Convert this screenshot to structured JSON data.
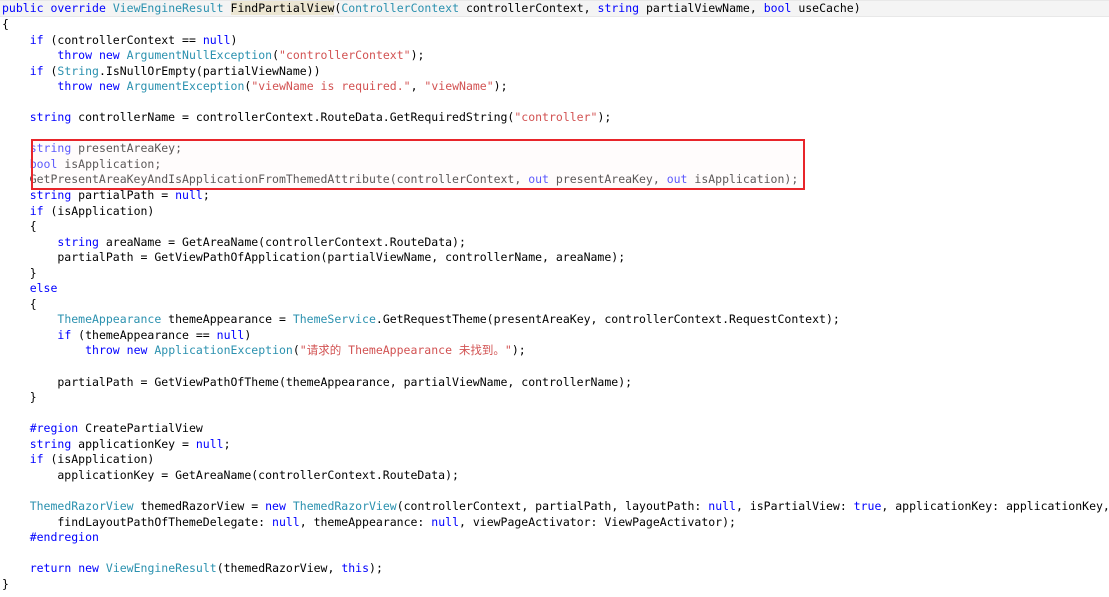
{
  "editor": {
    "language": "csharp",
    "colors": {
      "background": "#ffffff",
      "text": "#000000",
      "keyword": "#0000ff",
      "type": "#2b91af",
      "string": "#d25252",
      "preprocessor": "#0000ff",
      "current_line_background": "#f4f4f4",
      "symbol_highlight": "#ece6d2",
      "annotation_box": "#e8252a"
    },
    "annotation": {
      "name": "red-rectangle-highlight",
      "shape": "rectangle",
      "color": "#e8252a",
      "encloses_lines": [
        10,
        11,
        12
      ]
    },
    "lines": [
      {
        "n": 1,
        "current": true,
        "tokens": [
          {
            "t": "kw",
            "s": "public"
          },
          {
            "t": "plain",
            "s": " "
          },
          {
            "t": "kw",
            "s": "override"
          },
          {
            "t": "plain",
            "s": " "
          },
          {
            "t": "type",
            "s": "ViewEngineResult"
          },
          {
            "t": "plain",
            "s": " "
          },
          {
            "t": "hl",
            "s": "FindPartialView"
          },
          {
            "t": "plain",
            "s": "("
          },
          {
            "t": "type",
            "s": "ControllerContext"
          },
          {
            "t": "plain",
            "s": " controllerContext, "
          },
          {
            "t": "kw",
            "s": "string"
          },
          {
            "t": "plain",
            "s": " partialViewName, "
          },
          {
            "t": "kw",
            "s": "bool"
          },
          {
            "t": "plain",
            "s": " useCache)"
          }
        ]
      },
      {
        "n": 2,
        "tokens": [
          {
            "t": "plain",
            "s": "{"
          }
        ]
      },
      {
        "n": 3,
        "tokens": [
          {
            "t": "plain",
            "s": "    "
          },
          {
            "t": "kw",
            "s": "if"
          },
          {
            "t": "plain",
            "s": " (controllerContext == "
          },
          {
            "t": "kw",
            "s": "null"
          },
          {
            "t": "plain",
            "s": ")"
          }
        ]
      },
      {
        "n": 4,
        "tokens": [
          {
            "t": "plain",
            "s": "        "
          },
          {
            "t": "kw",
            "s": "throw"
          },
          {
            "t": "plain",
            "s": " "
          },
          {
            "t": "kw",
            "s": "new"
          },
          {
            "t": "plain",
            "s": " "
          },
          {
            "t": "type",
            "s": "ArgumentNullException"
          },
          {
            "t": "plain",
            "s": "("
          },
          {
            "t": "str",
            "s": "\"controllerContext\""
          },
          {
            "t": "plain",
            "s": ");"
          }
        ]
      },
      {
        "n": 5,
        "tokens": [
          {
            "t": "plain",
            "s": "    "
          },
          {
            "t": "kw",
            "s": "if"
          },
          {
            "t": "plain",
            "s": " ("
          },
          {
            "t": "type",
            "s": "String"
          },
          {
            "t": "plain",
            "s": ".IsNullOrEmpty(partialViewName))"
          }
        ]
      },
      {
        "n": 6,
        "tokens": [
          {
            "t": "plain",
            "s": "        "
          },
          {
            "t": "kw",
            "s": "throw"
          },
          {
            "t": "plain",
            "s": " "
          },
          {
            "t": "kw",
            "s": "new"
          },
          {
            "t": "plain",
            "s": " "
          },
          {
            "t": "type",
            "s": "ArgumentException"
          },
          {
            "t": "plain",
            "s": "("
          },
          {
            "t": "str",
            "s": "\"viewName is required.\""
          },
          {
            "t": "plain",
            "s": ", "
          },
          {
            "t": "str",
            "s": "\"viewName\""
          },
          {
            "t": "plain",
            "s": ");"
          }
        ]
      },
      {
        "n": 7,
        "tokens": [
          {
            "t": "plain",
            "s": ""
          }
        ]
      },
      {
        "n": 8,
        "tokens": [
          {
            "t": "plain",
            "s": "    "
          },
          {
            "t": "kw",
            "s": "string"
          },
          {
            "t": "plain",
            "s": " controllerName = controllerContext.RouteData.GetRequiredString("
          },
          {
            "t": "str",
            "s": "\"controller\""
          },
          {
            "t": "plain",
            "s": ");"
          }
        ]
      },
      {
        "n": 9,
        "tokens": [
          {
            "t": "plain",
            "s": ""
          }
        ]
      },
      {
        "n": 10,
        "tokens": [
          {
            "t": "plain",
            "s": "    "
          },
          {
            "t": "kw",
            "s": "string"
          },
          {
            "t": "plain",
            "s": " presentAreaKey;"
          }
        ]
      },
      {
        "n": 11,
        "tokens": [
          {
            "t": "plain",
            "s": "    "
          },
          {
            "t": "kw",
            "s": "bool"
          },
          {
            "t": "plain",
            "s": " isApplication;"
          }
        ]
      },
      {
        "n": 12,
        "tokens": [
          {
            "t": "plain",
            "s": "    GetPresentAreaKeyAndIsApplicationFromThemedAttribute(controllerContext, "
          },
          {
            "t": "kw",
            "s": "out"
          },
          {
            "t": "plain",
            "s": " presentAreaKey, "
          },
          {
            "t": "kw",
            "s": "out"
          },
          {
            "t": "plain",
            "s": " isApplication);"
          }
        ]
      },
      {
        "n": 13,
        "tokens": [
          {
            "t": "plain",
            "s": "    "
          },
          {
            "t": "kw",
            "s": "string"
          },
          {
            "t": "plain",
            "s": " partialPath = "
          },
          {
            "t": "kw",
            "s": "null"
          },
          {
            "t": "plain",
            "s": ";"
          }
        ]
      },
      {
        "n": 14,
        "tokens": [
          {
            "t": "plain",
            "s": "    "
          },
          {
            "t": "kw",
            "s": "if"
          },
          {
            "t": "plain",
            "s": " (isApplication)"
          }
        ]
      },
      {
        "n": 15,
        "tokens": [
          {
            "t": "plain",
            "s": "    {"
          }
        ]
      },
      {
        "n": 16,
        "tokens": [
          {
            "t": "plain",
            "s": "        "
          },
          {
            "t": "kw",
            "s": "string"
          },
          {
            "t": "plain",
            "s": " areaName = GetAreaName(controllerContext.RouteData);"
          }
        ]
      },
      {
        "n": 17,
        "tokens": [
          {
            "t": "plain",
            "s": "        partialPath = GetViewPathOfApplication(partialViewName, controllerName, areaName);"
          }
        ]
      },
      {
        "n": 18,
        "tokens": [
          {
            "t": "plain",
            "s": "    }"
          }
        ]
      },
      {
        "n": 19,
        "tokens": [
          {
            "t": "plain",
            "s": "    "
          },
          {
            "t": "kw",
            "s": "else"
          }
        ]
      },
      {
        "n": 20,
        "tokens": [
          {
            "t": "plain",
            "s": "    {"
          }
        ]
      },
      {
        "n": 21,
        "tokens": [
          {
            "t": "plain",
            "s": "        "
          },
          {
            "t": "type",
            "s": "ThemeAppearance"
          },
          {
            "t": "plain",
            "s": " themeAppearance = "
          },
          {
            "t": "type",
            "s": "ThemeService"
          },
          {
            "t": "plain",
            "s": ".GetRequestTheme(presentAreaKey, controllerContext.RequestContext);"
          }
        ]
      },
      {
        "n": 22,
        "tokens": [
          {
            "t": "plain",
            "s": "        "
          },
          {
            "t": "kw",
            "s": "if"
          },
          {
            "t": "plain",
            "s": " (themeAppearance == "
          },
          {
            "t": "kw",
            "s": "null"
          },
          {
            "t": "plain",
            "s": ")"
          }
        ]
      },
      {
        "n": 23,
        "tokens": [
          {
            "t": "plain",
            "s": "            "
          },
          {
            "t": "kw",
            "s": "throw"
          },
          {
            "t": "plain",
            "s": " "
          },
          {
            "t": "kw",
            "s": "new"
          },
          {
            "t": "plain",
            "s": " "
          },
          {
            "t": "type",
            "s": "ApplicationException"
          },
          {
            "t": "plain",
            "s": "("
          },
          {
            "t": "str",
            "s": "\"请求的 ThemeAppearance 未找到。\""
          },
          {
            "t": "plain",
            "s": ");"
          }
        ]
      },
      {
        "n": 24,
        "tokens": [
          {
            "t": "plain",
            "s": ""
          }
        ]
      },
      {
        "n": 25,
        "tokens": [
          {
            "t": "plain",
            "s": "        partialPath = GetViewPathOfTheme(themeAppearance, partialViewName, controllerName);"
          }
        ]
      },
      {
        "n": 26,
        "tokens": [
          {
            "t": "plain",
            "s": "    }"
          }
        ]
      },
      {
        "n": 27,
        "tokens": [
          {
            "t": "plain",
            "s": ""
          }
        ]
      },
      {
        "n": 28,
        "tokens": [
          {
            "t": "plain",
            "s": "    "
          },
          {
            "t": "pp",
            "s": "#region"
          },
          {
            "t": "plain",
            "s": " CreatePartialView"
          }
        ]
      },
      {
        "n": 29,
        "tokens": [
          {
            "t": "plain",
            "s": "    "
          },
          {
            "t": "kw",
            "s": "string"
          },
          {
            "t": "plain",
            "s": " applicationKey = "
          },
          {
            "t": "kw",
            "s": "null"
          },
          {
            "t": "plain",
            "s": ";"
          }
        ]
      },
      {
        "n": 30,
        "tokens": [
          {
            "t": "plain",
            "s": "    "
          },
          {
            "t": "kw",
            "s": "if"
          },
          {
            "t": "plain",
            "s": " (isApplication)"
          }
        ]
      },
      {
        "n": 31,
        "tokens": [
          {
            "t": "plain",
            "s": "        applicationKey = GetAreaName(controllerContext.RouteData);"
          }
        ]
      },
      {
        "n": 32,
        "tokens": [
          {
            "t": "plain",
            "s": ""
          }
        ]
      },
      {
        "n": 33,
        "tokens": [
          {
            "t": "plain",
            "s": "    "
          },
          {
            "t": "type",
            "s": "ThemedRazorView"
          },
          {
            "t": "plain",
            "s": " themedRazorView = "
          },
          {
            "t": "kw",
            "s": "new"
          },
          {
            "t": "plain",
            "s": " "
          },
          {
            "t": "type",
            "s": "ThemedRazorView"
          },
          {
            "t": "plain",
            "s": "(controllerContext, partialPath, layoutPath: "
          },
          {
            "t": "kw",
            "s": "null"
          },
          {
            "t": "plain",
            "s": ", isPartialView: "
          },
          {
            "t": "kw",
            "s": "true"
          },
          {
            "t": "plain",
            "s": ", applicationKey: applicationKey,"
          }
        ]
      },
      {
        "n": 34,
        "tokens": [
          {
            "t": "plain",
            "s": "        findLayoutPathOfThemeDelegate: "
          },
          {
            "t": "kw",
            "s": "null"
          },
          {
            "t": "plain",
            "s": ", themeAppearance: "
          },
          {
            "t": "kw",
            "s": "null"
          },
          {
            "t": "plain",
            "s": ", viewPageActivator: ViewPageActivator);"
          }
        ]
      },
      {
        "n": 35,
        "tokens": [
          {
            "t": "plain",
            "s": "    "
          },
          {
            "t": "pp",
            "s": "#endregion"
          }
        ]
      },
      {
        "n": 36,
        "tokens": [
          {
            "t": "plain",
            "s": ""
          }
        ]
      },
      {
        "n": 37,
        "tokens": [
          {
            "t": "plain",
            "s": "    "
          },
          {
            "t": "kw",
            "s": "return"
          },
          {
            "t": "plain",
            "s": " "
          },
          {
            "t": "kw",
            "s": "new"
          },
          {
            "t": "plain",
            "s": " "
          },
          {
            "t": "type",
            "s": "ViewEngineResult"
          },
          {
            "t": "plain",
            "s": "(themedRazorView, "
          },
          {
            "t": "kw",
            "s": "this"
          },
          {
            "t": "plain",
            "s": ");"
          }
        ]
      },
      {
        "n": 38,
        "tokens": [
          {
            "t": "plain",
            "s": "}"
          }
        ]
      }
    ]
  }
}
